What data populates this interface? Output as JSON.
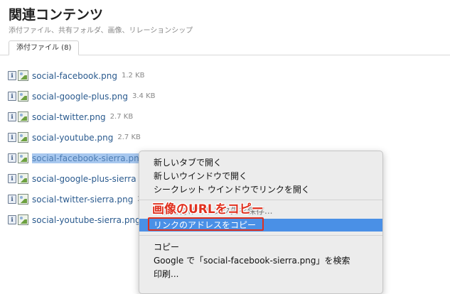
{
  "header": {
    "title": "関連コンテンツ",
    "subtitle": "添付ファイル、共有フォルダ、画像、リレーションシップ"
  },
  "tabs": [
    {
      "label": "添付ファイル (8)",
      "active": true
    }
  ],
  "files": [
    {
      "name": "social-facebook.png",
      "size": "1.2 KB"
    },
    {
      "name": "social-google-plus.png",
      "size": "3.4 KB"
    },
    {
      "name": "social-twitter.png",
      "size": "2.7 KB"
    },
    {
      "name": "social-youtube.png",
      "size": "2.7 KB"
    },
    {
      "name": "social-facebook-sierra.png",
      "size": ""
    },
    {
      "name": "social-google-plus-sierra",
      "size": ""
    },
    {
      "name": "social-twitter-sierra.png",
      "size": "2"
    },
    {
      "name": "social-youtube-sierra.png",
      "size": ""
    }
  ],
  "context_menu": {
    "items": [
      "新しいタブで開く",
      "新しいウインドウで開く",
      "シークレット ウインドウでリンクを開く",
      "名前を付けてリンク先を保存...",
      "リンクのアドレスをコピー",
      "コピー",
      "Google で「social-facebook-sierra.png」を検索",
      "印刷..."
    ]
  },
  "annotation": {
    "text": "画像のURLをコピー",
    "color": "#e0301e"
  },
  "colors": {
    "link": "#2a5a8e",
    "selection": "#a8c8ef",
    "menu_highlight": "#4a90e6",
    "menu_bg": "#ececec"
  },
  "icons": {
    "info": "info-icon",
    "image": "image-file-icon"
  }
}
